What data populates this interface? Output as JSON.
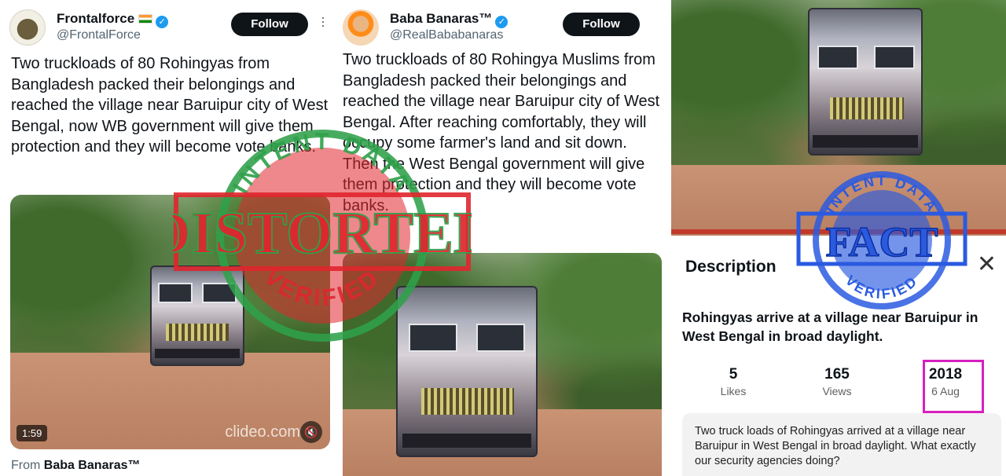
{
  "panel1": {
    "author_name": "Frontalforce",
    "author_handle": "@FrontalForce",
    "follow_label": "Follow",
    "tweet_text": "Two truckloads of 80 Rohingyas from Bangladesh packed their belongings and reached the village near Baruipur city of West Bengal, now WB government will give them protection and they will become vote banks.",
    "video_duration": "1:59",
    "video_watermark": "clideo.com",
    "from_prefix": "From",
    "from_name": "Baba Banaras™"
  },
  "panel2": {
    "author_name": "Baba Banaras™",
    "author_handle": "@RealBababanaras",
    "follow_label": "Follow",
    "tweet_text": "Two truckloads of 80 Rohingya Muslims from Bangladesh packed their belongings and reached the village near Baruipur city of West Bengal. After reaching comfortably, they will occupy some farmer's land and sit down. Then the West Bengal government will give them protection and they will become vote banks."
  },
  "panel3": {
    "sheet_title": "Description",
    "video_title": "Rohingyas arrive at a village near Baruipur in West Bengal in broad daylight.",
    "stats": [
      {
        "value": "5",
        "label": "Likes"
      },
      {
        "value": "165",
        "label": "Views"
      },
      {
        "value": "2018",
        "label": "6 Aug"
      }
    ],
    "description": "Two truck loads of Rohingyas arrived at a village near Baruipur in West Bengal in broad daylight. What exactly our security agencies doing?"
  },
  "stamps": {
    "distorted": {
      "main": "DISTORTED",
      "top": "INTENT DATA",
      "bottom": "VERIFIED"
    },
    "fact": {
      "main": "FACT",
      "top": "INTENT DATA",
      "bottom": "VERIFIED"
    }
  },
  "colors": {
    "follow_bg": "#0f1419",
    "verified_badge": "#1d9bf0",
    "highlight_border": "#d81fbf",
    "stamp_green": "#2fa04a",
    "stamp_red": "#e0262e",
    "stamp_blue": "#2a5ae0"
  },
  "icons": [
    "verified-badge-icon",
    "india-flag-icon",
    "more-options-icon",
    "mute-icon",
    "close-icon"
  ]
}
